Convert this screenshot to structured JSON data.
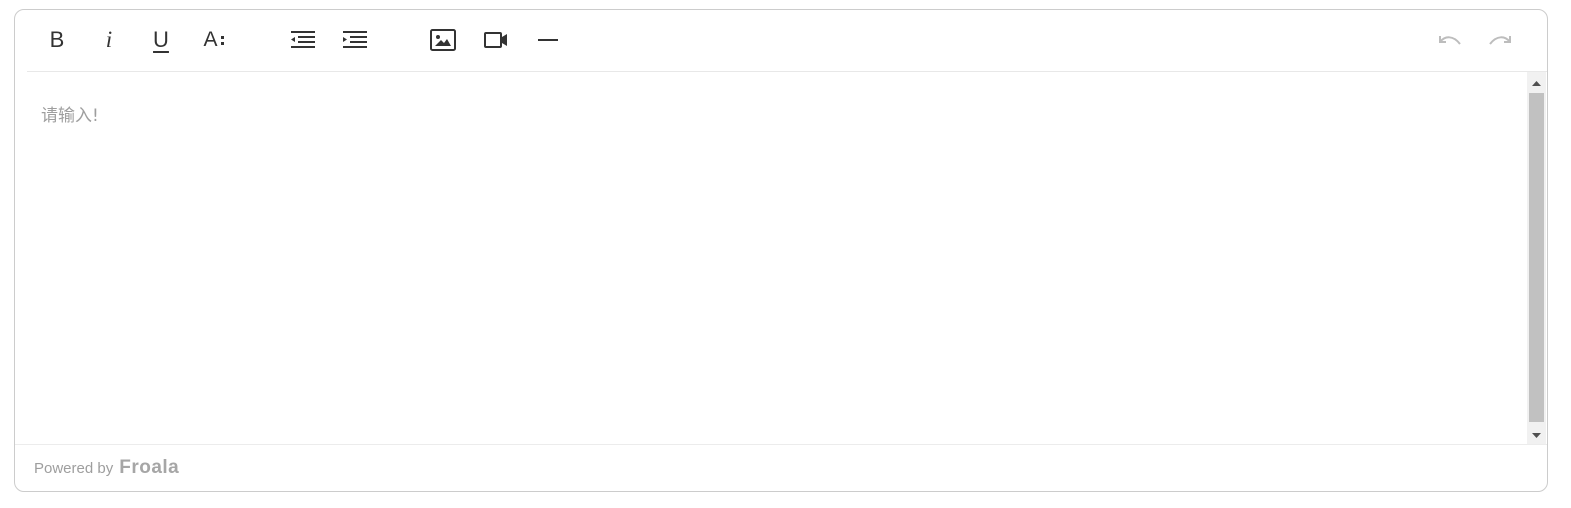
{
  "toolbar": {
    "buttons": [
      {
        "id": "bold",
        "label": "B",
        "icon": "bold-icon"
      },
      {
        "id": "italic",
        "label": "i",
        "icon": "italic-icon"
      },
      {
        "id": "underline",
        "label": "U",
        "icon": "underline-icon"
      },
      {
        "id": "paragraph-format",
        "label": "A:",
        "icon": "paragraph-format-icon"
      },
      {
        "id": "outdent",
        "icon": "outdent-icon"
      },
      {
        "id": "indent",
        "icon": "indent-icon"
      },
      {
        "id": "insert-image",
        "icon": "image-icon"
      },
      {
        "id": "insert-video",
        "icon": "video-icon"
      },
      {
        "id": "insert-hr",
        "icon": "horizontal-line-icon"
      },
      {
        "id": "undo",
        "icon": "undo-icon",
        "disabled": true
      },
      {
        "id": "redo",
        "icon": "redo-icon",
        "disabled": true
      }
    ],
    "bold_label": "B",
    "italic_label": "i",
    "underline_label": "U",
    "paragraph_label": "A"
  },
  "editor": {
    "placeholder": "请输入!"
  },
  "footer": {
    "powered_by": "Powered by",
    "brand": "Froala"
  },
  "colors": {
    "icon": "#333333",
    "disabled_icon": "#bdbdbd",
    "placeholder": "#9e9e9e",
    "border": "#cccccc",
    "scroll_thumb": "#c1c1c1"
  }
}
